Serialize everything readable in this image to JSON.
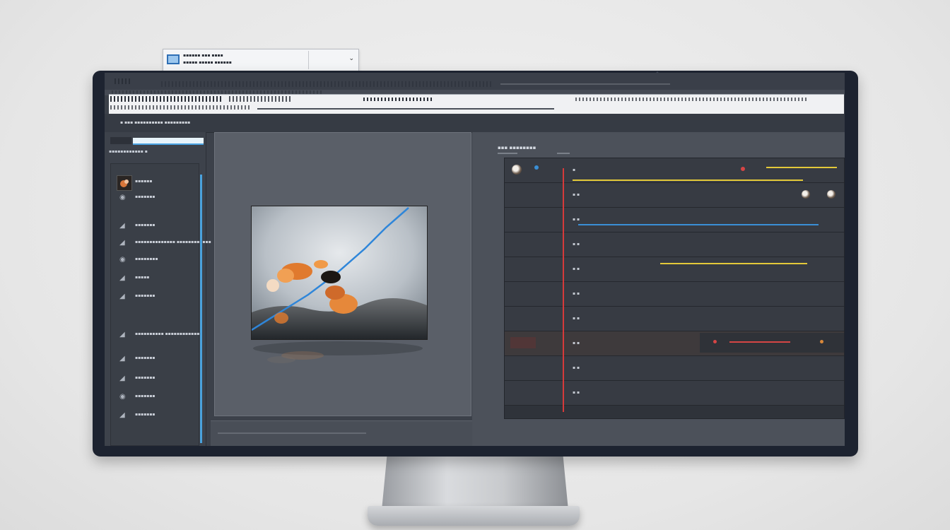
{
  "dialog": {
    "line1": "▪▪▪▪▪▪   ▪▪▪   ▪▪▪▪",
    "line2": "▪▪▪▪▪   ▪▪▪▪▪   ▪▪▪▪▪▪"
  },
  "subbar": {
    "label": "▪ ▪▪▪ ▪▪▪▪▪▪▪▪▪▪ ▪▪▪▪▪▪▪▪▪"
  },
  "left_panel": {
    "header": "▪▪▪▪▪▪▪▪▪▪▪▪ ▪",
    "items": [
      {
        "label": "▪▪▪▪▪▪"
      },
      {
        "label": "▪▪▪▪▪▪▪"
      },
      {
        "label": "▪▪▪▪▪▪▪"
      },
      {
        "label": "▪▪▪▪▪▪▪▪▪▪▪▪▪▪ ▪▪▪▪▪▪▪▪▪▪▪▪"
      },
      {
        "label": "▪▪▪▪▪▪▪▪"
      },
      {
        "label": "▪▪▪▪▪"
      },
      {
        "label": "▪▪▪▪▪▪▪"
      },
      {
        "label": "▪▪▪▪▪▪▪▪▪▪ ▪▪▪▪▪▪▪▪▪▪▪▪▪"
      },
      {
        "label": "▪▪▪▪▪▪▪"
      },
      {
        "label": "▪▪▪▪▪▪▪"
      },
      {
        "label": "▪▪▪▪▪▪▪"
      },
      {
        "label": "▪▪▪▪▪▪▪"
      }
    ]
  },
  "right_panel": {
    "title": "▪▪▪ ▪▪▪▪▪▪▪▪",
    "tracks": [
      {
        "label": "▪"
      },
      {
        "label": "▪ ▪"
      },
      {
        "label": "▪ ▪"
      },
      {
        "label": "▪ ▪"
      },
      {
        "label": "▪ ▪"
      },
      {
        "label": "▪ ▪"
      },
      {
        "label": "▪ ▪"
      },
      {
        "label": "▪ ▪"
      },
      {
        "label": "▪ ▪"
      },
      {
        "label": "▪ ▪"
      }
    ]
  },
  "colors": {
    "accent_blue": "#4ba3e3",
    "playhead_red": "#d63a3a",
    "track_yellow": "#e3c93a",
    "track_blue": "#3a8fd6",
    "track_red": "#d64545"
  }
}
